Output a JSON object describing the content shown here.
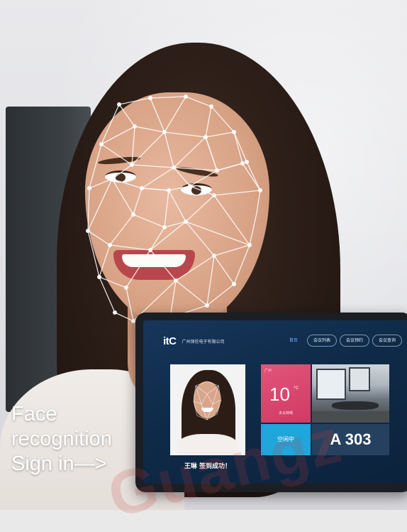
{
  "caption": {
    "line1": "Face",
    "line2": "recognition",
    "line3": "Sign in—>"
  },
  "tablet": {
    "brand_logo": "itC",
    "company_name": "广州保伦电子有限公司",
    "nav_tabs": [
      {
        "label": "首页",
        "active": true
      },
      {
        "label": "会议列表",
        "active": false
      },
      {
        "label": "会议预约",
        "active": false
      },
      {
        "label": "会议查询",
        "active": false
      }
    ],
    "success_message": "王琳  签到成功！",
    "weather": {
      "label": "广州",
      "temperature": "10",
      "unit": "°C",
      "city": "多云转晴"
    },
    "status": "空闲中",
    "room_number": "A 303"
  },
  "watermark": "Guangz",
  "colors": {
    "screen_bg": "#0f2a48",
    "weather_tile": "#e3557a",
    "status_tile": "#1fa6da",
    "room_tile": "#26415f",
    "active_tab": "#6fb3ff"
  }
}
